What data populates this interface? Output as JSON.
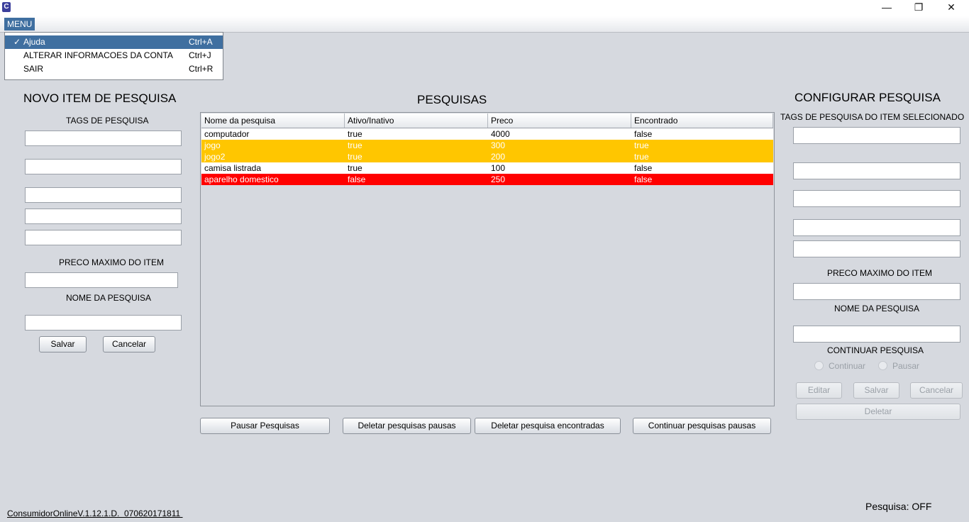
{
  "window": {
    "icon": "app-icon",
    "minimize_glyph": "—",
    "restore_glyph": "❐",
    "close_glyph": "✕"
  },
  "menu": {
    "label": "MENU",
    "items": [
      {
        "check": "✓",
        "label": "Ajuda",
        "shortcut": "Ctrl+A",
        "selected": true
      },
      {
        "check": "",
        "label": "ALTERAR INFORMACOES DA CONTA",
        "shortcut": "Ctrl+J",
        "selected": false
      },
      {
        "check": "",
        "label": "SAIR",
        "shortcut": "Ctrl+R",
        "selected": false
      }
    ]
  },
  "left_panel": {
    "title": "NOVO ITEM DE PESQUISA",
    "tags_label": "TAGS DE PESQUISA",
    "max_price_label": "PRECO MAXIMO DO ITEM",
    "search_name_label": "NOME DA PESQUISA",
    "save_label": "Salvar",
    "cancel_label": "Cancelar"
  },
  "center_panel": {
    "title": "PESQUISAS",
    "columns": [
      "Nome da pesquisa",
      "Ativo/Inativo",
      "Preco",
      "Encontrado"
    ],
    "rows": [
      {
        "name": "computador",
        "active": "true",
        "price": "4000",
        "found": "false",
        "color": "#ffffff"
      },
      {
        "name": "jogo",
        "active": "true",
        "price": "300",
        "found": "true",
        "color": "#ffc600"
      },
      {
        "name": "jogo2",
        "active": "true",
        "price": "200",
        "found": "true",
        "color": "#ffc600"
      },
      {
        "name": "camisa listrada",
        "active": "true",
        "price": "100",
        "found": "false",
        "color": "#ffffff"
      },
      {
        "name": "aparelho domestico",
        "active": "false",
        "price": "250",
        "found": "false",
        "color": "#ff0000"
      }
    ],
    "buttons": {
      "pause": "Pausar Pesquisas",
      "delete_paused": "Deletar pesquisas pausas",
      "delete_found": "Deletar pesquisa encontradas",
      "continue_paused": "Continuar pesquisas pausas"
    }
  },
  "right_panel": {
    "title": "CONFIGURAR PESQUISA",
    "tags_label": "TAGS DE PESQUISA DO ITEM SELECIONADO",
    "max_price_label": "PRECO MAXIMO DO ITEM",
    "search_name_label": "NOME DA PESQUISA",
    "continue_label": "CONTINUAR PESQUISA",
    "radio_continue": "Continuar",
    "radio_pause": "Pausar",
    "edit_label": "Editar",
    "save_label": "Salvar",
    "cancel_label": "Cancelar",
    "delete_label": "Deletar"
  },
  "footer": {
    "version": "ConsumidorOnlineV.1.12.1.D.  070620171811 ",
    "status": "Pesquisa: OFF"
  }
}
